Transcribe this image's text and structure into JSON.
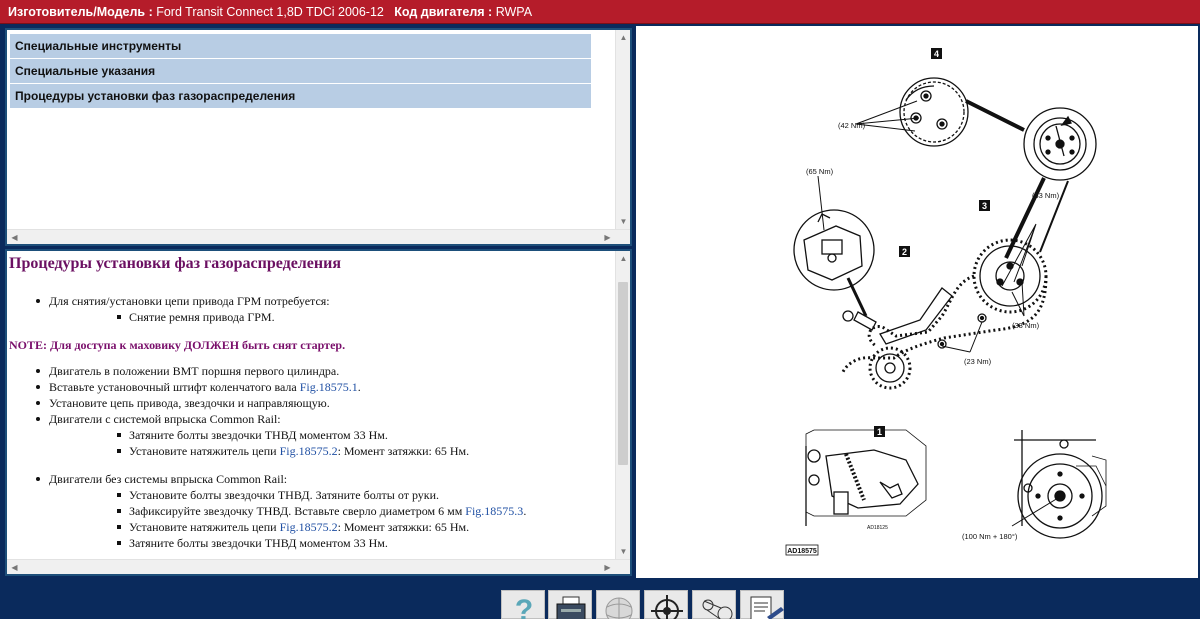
{
  "header": {
    "manufacturer_label": "Изготовитель/Модель :",
    "model": "Ford Transit Connect 1,8D TDCi 2006-12",
    "engine_label": "Код двигателя :",
    "engine_code": "RWPA"
  },
  "menu": {
    "items": [
      "Специальные инструменты",
      "Специальные указания",
      "Процедуры установки фаз газораспределения"
    ]
  },
  "content": {
    "title": "Процедуры установки фаз газораспределения",
    "l1a": "Для снятия/установки цепи привода ГРМ потребуется:",
    "l2a": "Снятие ремня привода ГРМ.",
    "note": "NOTE: Для доступа к маховику ДОЛЖЕН быть снят стартер.",
    "l1b": "Двигатель в положении ВМТ поршня первого цилиндра.",
    "l1c_text": "Вставьте установочный штифт коленчатого вала ",
    "l1c_link": "Fig.18575.1",
    "l1c_end": ".",
    "l1d": "Установите цепь привода, звездочки и направляющую.",
    "l1e": "Двигатели с системой впрыска Common Rail:",
    "l2b": "Затяните болты звездочки ТНВД моментом 33 Нм.",
    "l2c_text": "Установите натяжитель цепи ",
    "l2c_link": "Fig.18575.2",
    "l2c_end": ": Момент затяжки: 65 Нм.",
    "l1f": "Двигатели без системы впрыска Common Rail:",
    "l2d": "Установите болты звездочки ТНВД. Затяните болты от руки.",
    "l2e_text": "Зафиксируйте звездочку ТНВД. Вставьте сверло диаметром 6 мм ",
    "l2e_link": "Fig.18575.3",
    "l2e_end": ".",
    "l2f_text": "Установите натяжитель цепи ",
    "l2f_link": "Fig.18575.2",
    "l2f_end": ": Момент затяжки: 65 Нм.",
    "l2g": "Затяните болты звездочки ТНВД моментом 33 Нм."
  },
  "diagram": {
    "callout_4": "4",
    "callout_3": "3",
    "callout_2": "2",
    "callout_1": "1",
    "torque_42": "(42 Nm)",
    "torque_65": "(65 Nm)",
    "torque_33a": "(33 Nm)",
    "torque_33b": "(33 Nm)",
    "torque_23": "(23 Nm)",
    "torque_100": "(100 Nm + 180°)",
    "small_label": "AD18125",
    "fig_id": "AD18575"
  },
  "toolbar": {
    "help_icon": "question-mark",
    "print_icon": "printer",
    "globe_icon": "globe",
    "crosshair_icon": "target",
    "belt_icon": "belt",
    "notes_icon": "document-pen"
  }
}
